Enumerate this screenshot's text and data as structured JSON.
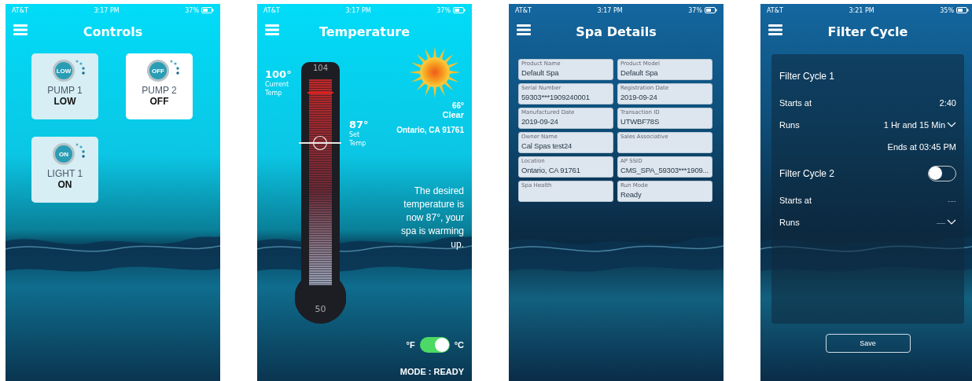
{
  "screens": [
    {
      "kind": "controls",
      "status": {
        "carrier": "AT&T",
        "time": "3:17 PM",
        "battery": "37%"
      },
      "title": "Controls",
      "cards": [
        {
          "dial_label": "LOW",
          "name": "PUMP 1",
          "state": "LOW",
          "on": true
        },
        {
          "dial_label": "OFF",
          "name": "PUMP 2",
          "state": "OFF",
          "on": false
        },
        {
          "dial_label": "ON",
          "name": "LIGHT 1",
          "state": "ON",
          "on": true
        }
      ]
    },
    {
      "kind": "temperature",
      "status": {
        "carrier": "AT&T",
        "time": "3:17 PM",
        "battery": "37%"
      },
      "title": "Temperature",
      "current": {
        "value": "100°",
        "label_1": "Current",
        "label_2": "Temp"
      },
      "thermometer": {
        "max": "104",
        "min": "50",
        "level": 0.69
      },
      "set": {
        "value": "87°",
        "label_1": "Set",
        "label_2": "Temp"
      },
      "weather": {
        "temp": "66°",
        "condition": "Clear",
        "location": "Ontario, CA 91761"
      },
      "message": "The desired temperature is now 87°, your spa is warming up.",
      "unit_toggle": {
        "left": "°F",
        "right": "°C",
        "on": true
      },
      "mode": "MODE : READY"
    },
    {
      "kind": "details",
      "status": {
        "carrier": "AT&T",
        "time": "3:17 PM",
        "battery": "37%"
      },
      "title": "Spa Details",
      "fields": [
        {
          "label": "Product Name",
          "value": "Default Spa"
        },
        {
          "label": "Product Model",
          "value": "Default Spa"
        },
        {
          "label": "Serial Number",
          "value": "59303***1909240001"
        },
        {
          "label": "Registration Date",
          "value": "2019-09-24"
        },
        {
          "label": "Manufactured Date",
          "value": "2019-09-24"
        },
        {
          "label": "Transaction ID",
          "value": "UTWBF78S"
        },
        {
          "label": "Owner Name",
          "value": "Cal Spas test24"
        },
        {
          "label": "Sales Associative"
        },
        {
          "label": "Location",
          "value": "Ontario, CA 91761"
        },
        {
          "label": "AP SSID",
          "value": "CMS_SPA_59303***1909..."
        },
        {
          "label": "Spa Health"
        },
        {
          "label": "Run Mode",
          "value": "Ready"
        }
      ]
    },
    {
      "kind": "filter",
      "status": {
        "carrier": "AT&T",
        "time": "3:21 PM",
        "battery": "35%"
      },
      "title": "Filter Cycle",
      "cycles": [
        {
          "title": "Filter Cycle 1",
          "starts_label": "Starts at",
          "starts": "2:40",
          "runs_label": "Runs",
          "runs": "1 Hr and 15 Min",
          "ends": "Ends at 03:45 PM"
        },
        {
          "title": "Filter Cycle 2",
          "toggle_on": false,
          "starts_label": "Starts at",
          "starts": "---",
          "runs_label": "Runs",
          "runs": "—"
        }
      ],
      "save": "Save"
    }
  ]
}
